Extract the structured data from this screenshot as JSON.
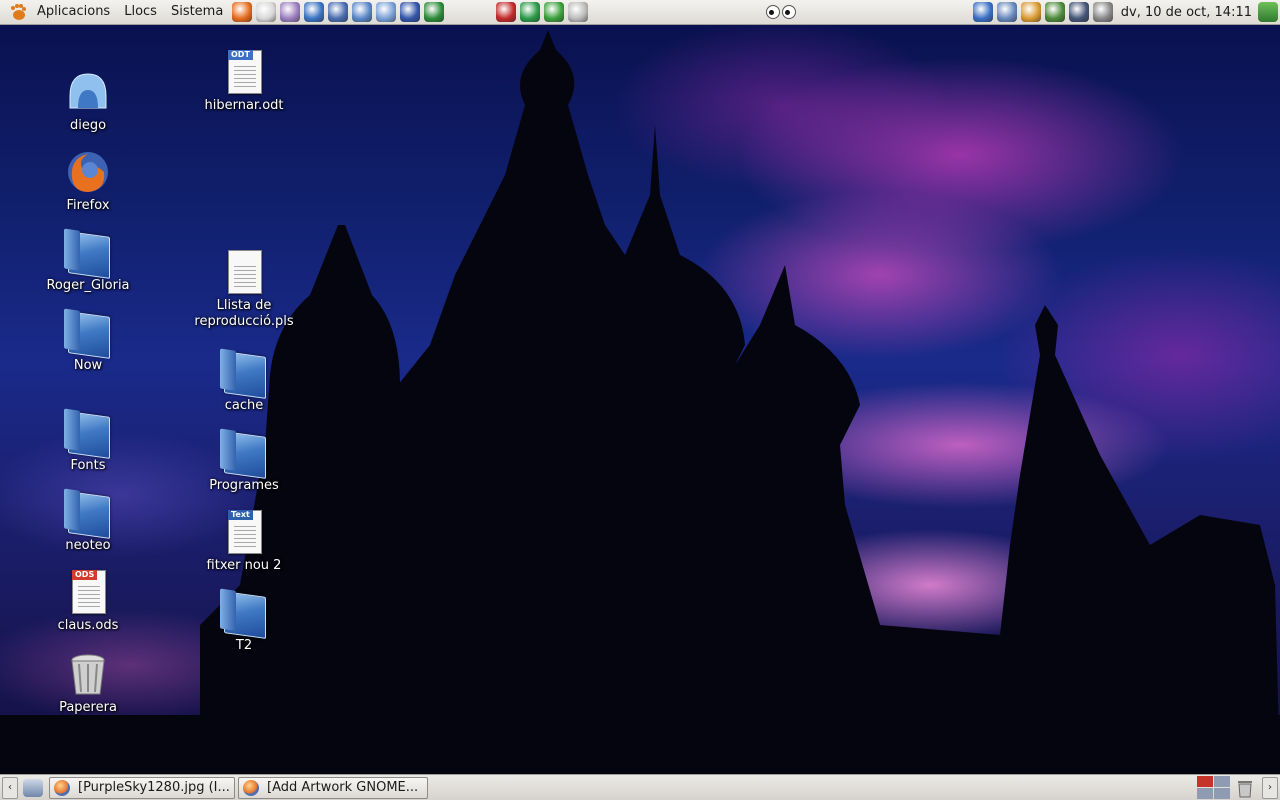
{
  "top_panel": {
    "menus": [
      "Aplicacions",
      "Llocs",
      "Sistema"
    ],
    "launchers": [
      {
        "name": "firefox-icon",
        "color": "#e66a1d"
      },
      {
        "name": "mail-icon",
        "color": "#d8d8d8"
      },
      {
        "name": "pidgin-icon",
        "color": "#9b7fbf"
      },
      {
        "name": "thunderbird-icon",
        "color": "#3b73c2"
      },
      {
        "name": "shield-icon",
        "color": "#4a6cb0"
      },
      {
        "name": "network-icon",
        "color": "#5a87c8"
      },
      {
        "name": "grid-icon",
        "color": "#7aa0d6"
      },
      {
        "name": "screen-icon",
        "color": "#3355aa"
      },
      {
        "name": "spreadsheet-icon",
        "color": "#2e8b3a"
      }
    ],
    "applets": [
      {
        "name": "gift-icon",
        "color": "#c22b2b"
      },
      {
        "name": "globe-icon",
        "color": "#2c9a4a"
      },
      {
        "name": "skype-icon",
        "color": "#3ba03b"
      },
      {
        "name": "computer-icon",
        "color": "#bbbbbb"
      }
    ],
    "tray": [
      {
        "name": "bluetooth-icon",
        "color": "#3a6fc4"
      },
      {
        "name": "update-icon",
        "color": "#6688bb"
      },
      {
        "name": "search-icon",
        "color": "#d99a33"
      },
      {
        "name": "wifi-icon",
        "color": "#4d8a3a"
      },
      {
        "name": "time-icon",
        "color": "#445577"
      },
      {
        "name": "volume-icon",
        "color": "#888888"
      }
    ],
    "clock": "dv, 10 de oct, 14:11"
  },
  "desktop": {
    "column1": [
      {
        "label": "diego",
        "kind": "home"
      },
      {
        "label": "Firefox",
        "kind": "firefox"
      },
      {
        "label": "Roger_Gloria",
        "kind": "folder"
      },
      {
        "label": "Now",
        "kind": "folder"
      },
      {
        "label": "Fonts",
        "kind": "folder"
      },
      {
        "label": "neoteo",
        "kind": "folder"
      },
      {
        "label": "claus.ods",
        "kind": "ods"
      },
      {
        "label": "Paperera",
        "kind": "trash"
      }
    ],
    "column2": [
      {
        "label": "hibernar.odt",
        "kind": "odt"
      },
      {
        "label": "Llista de reproducció.pls",
        "kind": "text"
      },
      {
        "label": "cache",
        "kind": "folder"
      },
      {
        "label": "Programes",
        "kind": "folder"
      },
      {
        "label": "fitxer nou 2",
        "kind": "txt"
      },
      {
        "label": "T2",
        "kind": "folder"
      }
    ],
    "badges": {
      "odt": "ODT",
      "ods": "ODS",
      "txt": "Text"
    }
  },
  "bottom_panel": {
    "tasks": [
      {
        "label": "[PurpleSky1280.jpg (I..."
      },
      {
        "label": "[Add Artwork GNOME..."
      }
    ],
    "scroll_left": "‹",
    "scroll_right": "›"
  }
}
